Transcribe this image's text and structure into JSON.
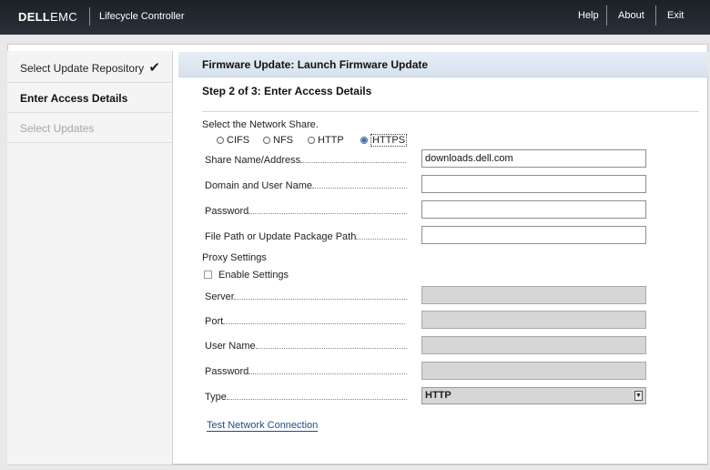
{
  "header": {
    "brand_dell": "DELL",
    "brand_emc": "EMC",
    "app_title": "Lifecycle Controller",
    "links": {
      "help": "Help",
      "about": "About",
      "exit": "Exit"
    }
  },
  "sidebar": {
    "steps": [
      {
        "label": "Select Update Repository",
        "state": "done"
      },
      {
        "label": "Enter Access Details",
        "state": "active"
      },
      {
        "label": "Select Updates",
        "state": "disabled"
      }
    ]
  },
  "page": {
    "heading": "Firmware Update: Launch Firmware Update",
    "step_title": "Step 2 of 3: Enter Access Details"
  },
  "network_share": {
    "label": "Select the Network Share.",
    "options": [
      "CIFS",
      "NFS",
      "HTTP",
      "HTTPS"
    ],
    "selected": "HTTPS"
  },
  "form": {
    "share_label": "Share Name/Address",
    "share_value": "downloads.dell.com",
    "domain_label": "Domain and User Name",
    "domain_value": "",
    "password_label": "Password",
    "password_value": "",
    "filepath_label": "File Path or Update Package Path",
    "filepath_value": ""
  },
  "proxy": {
    "section_label": "Proxy Settings",
    "enable_label": "Enable Settings",
    "enabled": false,
    "server_label": "Server",
    "port_label": "Port",
    "username_label": "User Name",
    "password_label": "Password",
    "type_label": "Type",
    "type_value": "HTTP"
  },
  "actions": {
    "test_connection": "Test Network Connection"
  },
  "colors": {
    "topbar": "#1c2128",
    "accent_link": "#1a4f8a",
    "heading_band": "#dce6f0"
  }
}
